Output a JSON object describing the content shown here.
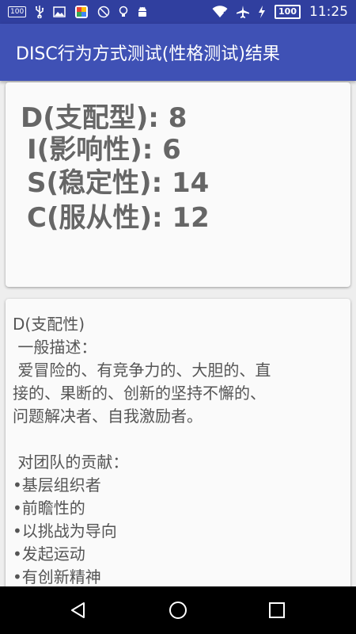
{
  "status_bar": {
    "time": "11:25",
    "battery": "100",
    "notification_badge": "100",
    "icons": [
      "notification-count-icon",
      "usb-icon",
      "image-icon",
      "app-store-icon",
      "blocked-icon",
      "lightbulb-icon",
      "android-icon",
      "wifi-icon",
      "airplane-icon",
      "charging-icon",
      "battery-icon"
    ]
  },
  "app_bar": {
    "title": "DISC行为方式测试(性格测试)结果"
  },
  "scores": [
    {
      "label": "D(支配型): 8"
    },
    {
      "label": "I(影响性): 6"
    },
    {
      "label": "S(稳定性): 14"
    },
    {
      "label": "C(服从性): 12"
    }
  ],
  "description": {
    "lines": [
      "D(支配性)",
      " 一般描述：",
      " 爱冒险的、有竞争力的、大胆的、直",
      "接的、果断的、创新的坚持不懈的、",
      "问题解决者、自我激励者。",
      "",
      " 对团队的贡献：",
      "•基层组织者",
      "•前瞻性的",
      "•以挑战为导向",
      "•发起运动",
      "•有创新精神"
    ]
  },
  "nav_bar": {
    "buttons": [
      "back",
      "home",
      "recents"
    ]
  },
  "colors": {
    "status_bar": "#303f9f",
    "app_bar": "#3f51b5",
    "score_text": "#666666"
  }
}
